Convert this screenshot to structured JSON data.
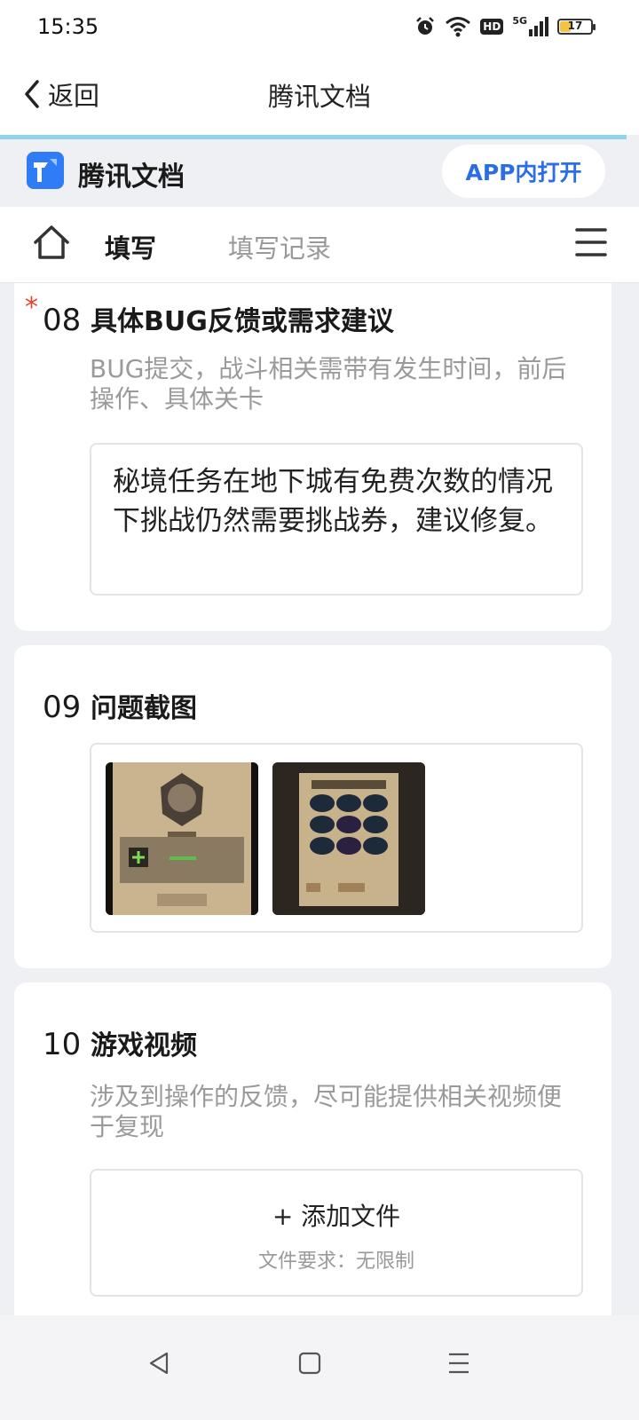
{
  "status_bar": {
    "time": "15:35",
    "hd_label": "HD",
    "network_label": "5G",
    "battery": "17"
  },
  "nav": {
    "back_label": "返回",
    "title": "腾讯文档"
  },
  "brand": {
    "name": "腾讯文档",
    "open_app_label": "APP内打开"
  },
  "tabs": {
    "fill": "填写",
    "history": "填写记录"
  },
  "questions": [
    {
      "number": "08",
      "required_mark": "*",
      "title": "具体BUG反馈或需求建议",
      "description": "BUG提交，战斗相关需带有发生时间，前后操作、具体关卡",
      "answer": "秘境任务在地下城有免费次数的情况下挑战仍然需要挑战券，建议修复。"
    },
    {
      "number": "09",
      "title": "问题截图"
    },
    {
      "number": "10",
      "title": "游戏视频",
      "description": "涉及到操作的反馈，尽可能提供相关视频便于复现",
      "add_file_label": "+ 添加文件",
      "file_requirement": "文件要求：无限制"
    }
  ],
  "colors": {
    "accent": "#2b6de8",
    "required": "#e8412c",
    "progress": "#8fd3ec"
  }
}
